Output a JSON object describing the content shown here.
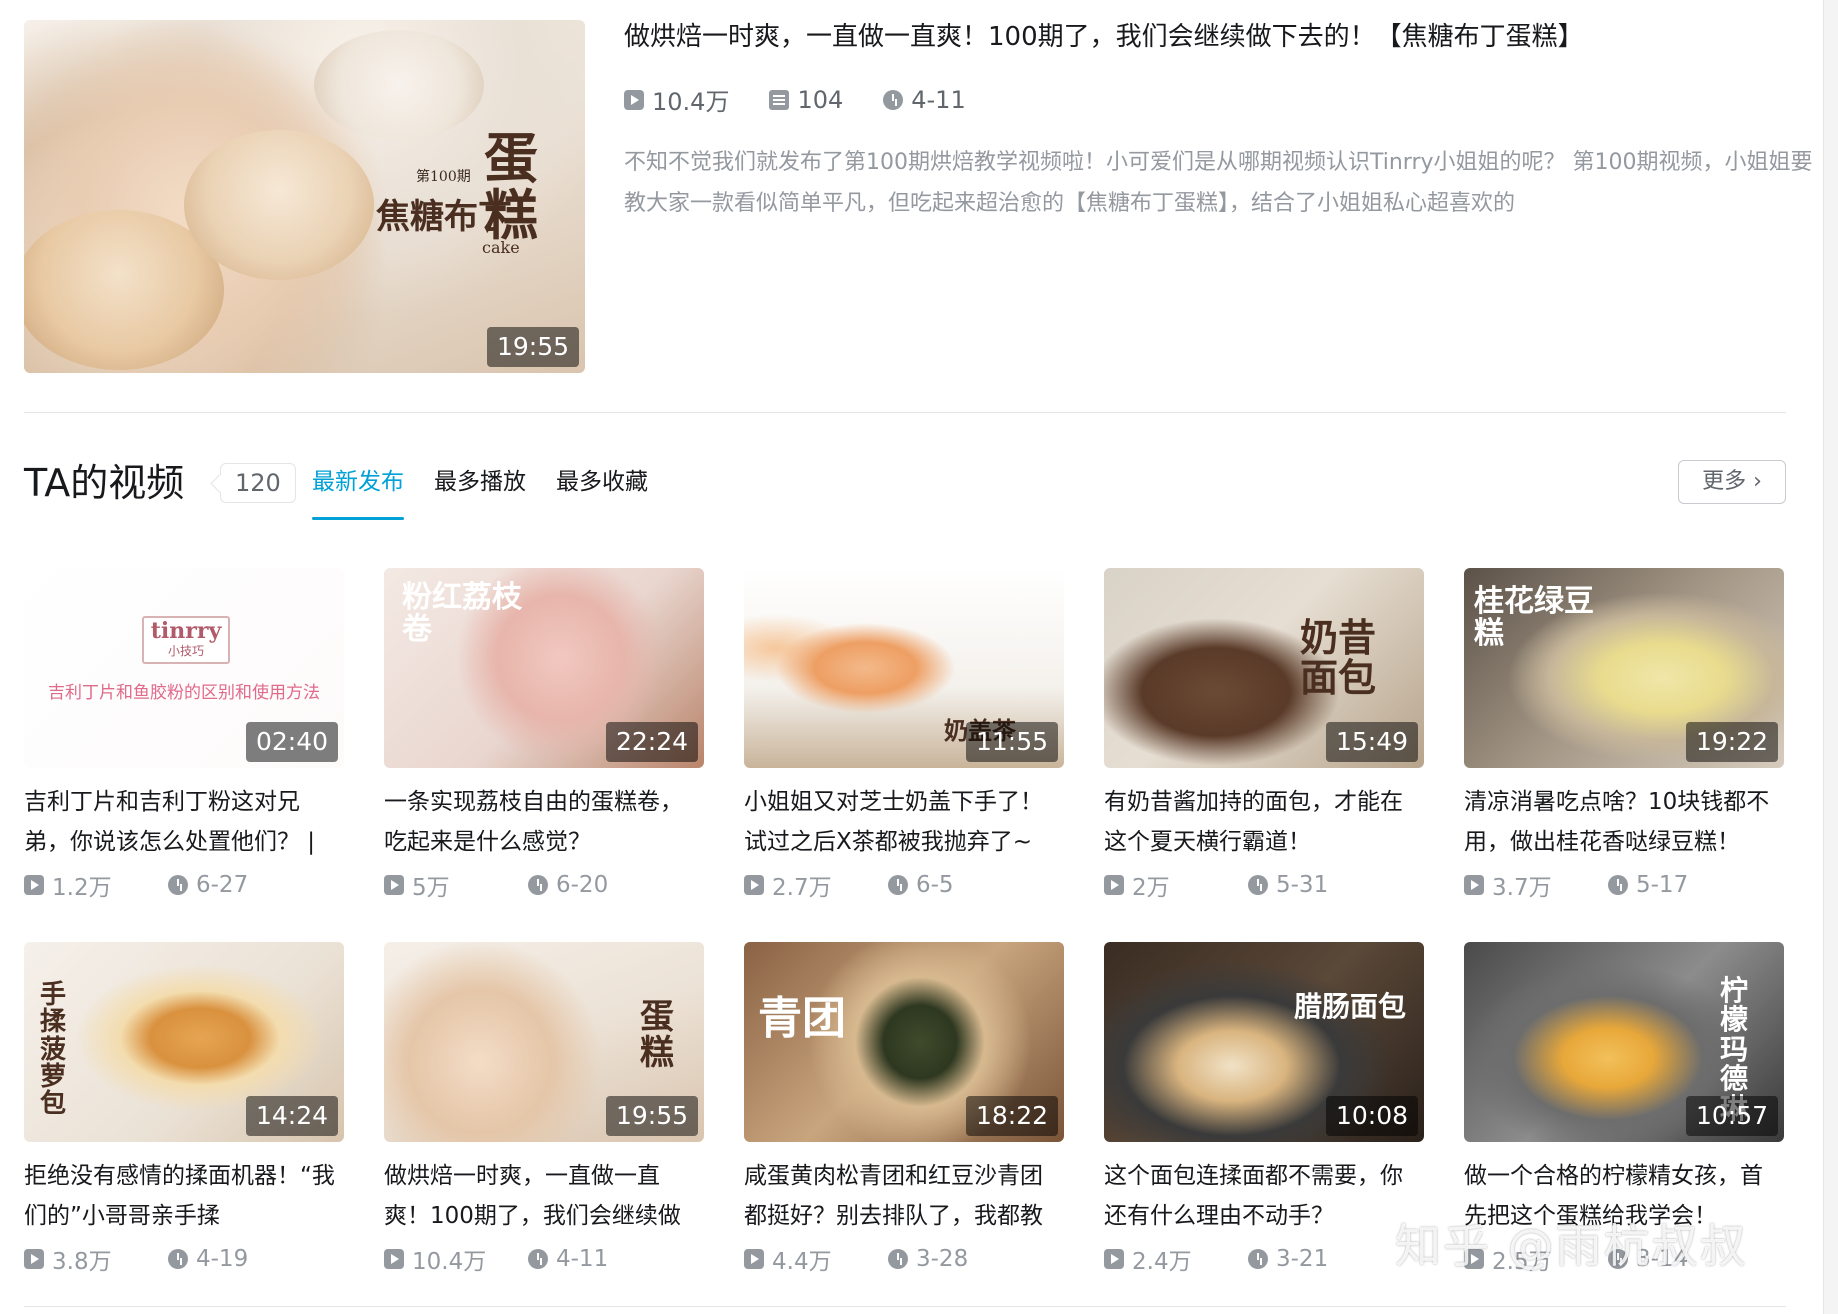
{
  "featured": {
    "title": "做烘焙一时爽，一直做一直爽！100期了，我们会继续做下去的！【焦糖布丁蛋糕】",
    "views": "10.4万",
    "danmaku": "104",
    "date": "4-11",
    "duration": "19:55",
    "description": "不知不觉我们就发布了第100期烘焙教学视频啦！小可爱们是从哪期视频认识Tinrry小姐姐的呢？ 第100期视频，小姐姐要教大家一款看似简单平凡，但吃起来超治愈的【焦糖布丁蛋糕】，结合了小姐姐私心超喜欢的",
    "overlay": {
      "issue": "第100期",
      "title1": "蛋糕",
      "title2": "焦糖布丁",
      "sub": "cake"
    }
  },
  "section": {
    "title": "TA的视频",
    "count": "120",
    "tabs": [
      {
        "label": "最新发布",
        "active": true
      },
      {
        "label": "最多播放",
        "active": false
      },
      {
        "label": "最多收藏",
        "active": false
      }
    ],
    "more_label": "更多"
  },
  "videos": [
    {
      "title": "吉利丁片和吉利丁粉这对兄弟，你说该怎么处置他们？ |",
      "views": "1.2万",
      "date": "6-27",
      "duration": "02:40",
      "bg": "linear-gradient(135deg,#ffffff 0%,#fdfafa 100%)",
      "overlay": ""
    },
    {
      "title": "一条实现荔枝自由的蛋糕卷，吃起来是什么感觉？",
      "views": "5万",
      "date": "6-20",
      "duration": "22:24",
      "bg": "radial-gradient(circle at 55% 45%,#f1c8c0 0%,#e7b5ab 30%,transparent 50%),linear-gradient(135deg,#f4e9e4 0%,#e9d6cf 55%,#b9846a 100%)",
      "overlay": "粉红荔枝卷"
    },
    {
      "title": "小姐姐又对芝士奶盖下手了！试过之后X茶都被我抛弃了~",
      "views": "2.7万",
      "date": "6-5",
      "duration": "11:55",
      "bg": "radial-gradient(ellipse at 38% 50%,#f3b98a 0%,#ee9f63 18%,transparent 32%),radial-gradient(ellipse at 10% 40%,#f6c79b 0%,transparent 20%),linear-gradient(180deg,#ffffff 0%,#f4f1ec 60%,#c9b49a 100%)",
      "overlay": "奶盖茶"
    },
    {
      "title": "有奶昔酱加持的面包，才能在这个夏天横行霸道！",
      "views": "2万",
      "date": "5-31",
      "duration": "15:49",
      "bg": "radial-gradient(ellipse at 35% 62%,#6b4a35 0%,#5a3a28 25%,transparent 42%),linear-gradient(135deg,#d9d2c7 0%,#e6ded2 45%,#b7a48c 100%)",
      "overlay": "奶昔面包"
    },
    {
      "title": "清凉消暑吃点啥？10块钱都不用，做出桂花香哒绿豆糕！",
      "views": "3.7万",
      "date": "5-17",
      "duration": "19:22",
      "bg": "radial-gradient(ellipse at 62% 55%,#f0e6a8 0%,#e9dc8e 22%,#c7b79a 40%,transparent 55%),linear-gradient(135deg,#5b5148 0%,#a49786 50%,#d7ccbd 100%)",
      "overlay": "桂花绿豆糕"
    },
    {
      "title": "拒绝没有感情的揉面机器！“我们的”小哥哥亲手揉",
      "views": "3.8万",
      "date": "4-19",
      "duration": "14:24",
      "bg": "radial-gradient(ellipse at 55% 48%,#e6a552 0%,#d9913e 20%,#f3dcae 32%,transparent 50%),linear-gradient(135deg,#f5f0ea 0%,#ebe2d6 60%,#d7c4ad 100%)",
      "overlay": "手揉菠萝包"
    },
    {
      "title": "做烘焙一时爽，一直做一直爽！100期了，我们会继续做",
      "views": "10.4万",
      "date": "4-11",
      "duration": "19:55",
      "bg": "radial-gradient(circle at 30% 60%,#f3dcc6 0%,#e5c6a8 28%,transparent 48%),linear-gradient(160deg,#f5efe8 0%,#ece2d6 50%,#d9c4ae 100%)",
      "overlay": "蛋糕"
    },
    {
      "title": "咸蛋黄肉松青团和红豆沙青团都挺好？别去排队了，我都教",
      "views": "4.4万",
      "date": "3-28",
      "duration": "18:22",
      "bg": "radial-gradient(circle at 55% 50%,#3f4a2c 0%,#2e3820 18%,#d7b98f 32%,transparent 55%),linear-gradient(135deg,#8a6244 0%,#c9a57e 50%,#7a5438 100%)",
      "overlay": "青团"
    },
    {
      "title": "这个面包连揉面都不需要，你还有什么理由不动手？",
      "views": "2.4万",
      "date": "3-21",
      "duration": "10:08",
      "bg": "radial-gradient(ellipse at 40% 62%,#f1e2c6 0%,#d9b47f 20%,#3a3a3a 40%,transparent 60%),linear-gradient(135deg,#3a2c22 0%,#5a4838 50%,#2a211b 100%)",
      "overlay": "腊肠面包"
    },
    {
      "title": "做一个合格的柠檬精女孩，首先把这个蛋糕给我学会！",
      "views": "2.5万",
      "date": "3-14",
      "duration": "10:57",
      "bg": "radial-gradient(ellipse at 45% 58%,#f2c05a 0%,#e8a83a 18%,#6d6d6d 38%,transparent 58%),linear-gradient(135deg,#4a4a4a 0%,#8c8c8c 50%,#3a3a3a 100%)",
      "overlay": "柠檬玛德琳"
    }
  ],
  "first_card_logo": {
    "brand": "tinrry",
    "sub": "小技巧",
    "caption": "吉利丁片和鱼胶粉的区别和使用方法"
  },
  "watermark": "知乎 @雨杭叔叔"
}
